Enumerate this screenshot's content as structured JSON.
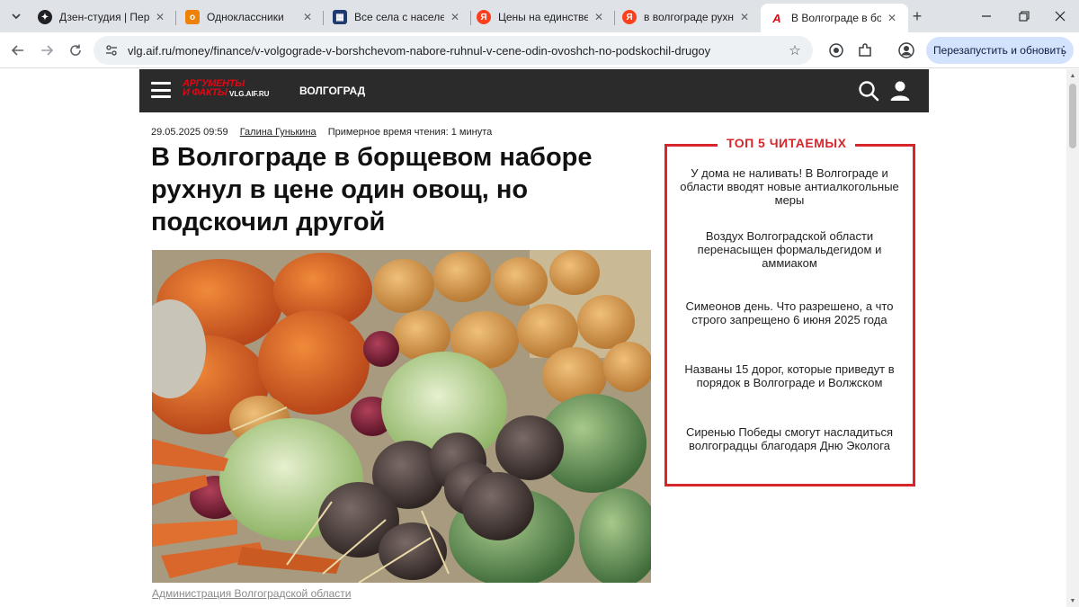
{
  "browser": {
    "tabs": [
      {
        "title": "Дзен-студия | Переехать",
        "favicon": "dzen-icon",
        "active": false
      },
      {
        "title": "Одноклассники",
        "favicon": "ok-icon",
        "active": false
      },
      {
        "title": "Все села с населением",
        "favicon": "table-icon",
        "active": false
      },
      {
        "title": "Цены на единственное",
        "favicon": "yandex-icon",
        "active": false
      },
      {
        "title": "в волгограде рухнул",
        "favicon": "yandex-icon",
        "active": false
      },
      {
        "title": "В Волгограде в борщево",
        "favicon": "aif-icon",
        "active": true
      }
    ],
    "url": "vlg.aif.ru/money/finance/v-volgograde-v-borshchevom-nabore-ruhnul-v-cene-odin-ovoshch-no-podskochil-drugoy",
    "restart_label": "Перезапустить и обновить"
  },
  "site": {
    "logo_line1": "АРГУМЕНТЫ",
    "logo_line2": "И ФАКТЫ",
    "logo_domain": "VLG.AIF.RU",
    "city": "ВОЛГОГРАД",
    "brand_color": "#e30613"
  },
  "article": {
    "datetime": "29.05.2025 09:59",
    "author": "Галина Гунькина",
    "read_time": "Примерное время чтения: 1 минута",
    "headline": "В Волгограде в борщевом наборе рухнул в цене один овощ, но подскочил другой",
    "photo_caption": "Администрация Волгоградской области"
  },
  "top5": {
    "title": "ТОП 5 ЧИТАЕМЫХ",
    "accent": "#d6262b",
    "items": [
      "У дома не наливать! В Волгограде и области вводят новые антиалкогольные меры",
      "Воздух Волгоградской области перенасыщен формальдегидом и аммиаком",
      "Симеонов день. Что разрешено, а что строго запрещено 6 июня 2025 года",
      "Названы 15 дорог, которые приведут в порядок в Волгограде и Волжском",
      "Сиренью Победы смогут насладиться волгоградцы благодаря Дню Эколога"
    ]
  }
}
